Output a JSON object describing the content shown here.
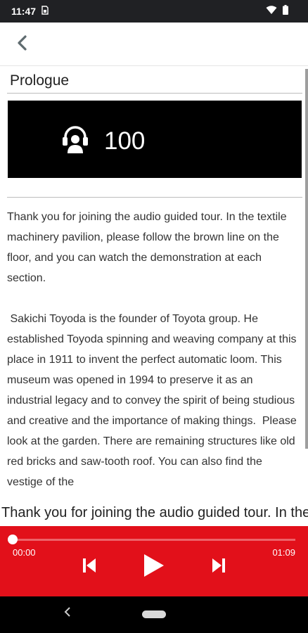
{
  "status_bar": {
    "time": "11:47",
    "sim_icon": "sim-card-icon",
    "wifi_icon": "wifi-icon",
    "battery_icon": "battery-icon"
  },
  "app_bar": {
    "back_icon": "chevron-left-icon"
  },
  "content": {
    "section_title": "Prologue",
    "track": {
      "icon": "headphone-person-icon",
      "number": "100",
      "background": "#000000"
    },
    "body_text": "Thank you for joining the audio guided tour. In the textile machinery pavilion, please follow the brown line on the floor, and you can watch the demonstration at each section.\n\n Sakichi Toyoda is the founder of Toyota group. He established Toyoda spinning and weaving company at this place in 1911 to invent the perfect automatic loom. This museum was opened in 1994 to preserve it as an industrial legacy and to convey the spirit of being studious and creative and the importance of making things.  Please look at the garden. There are remaining structures like old red bricks and saw-tooth roof. You can also find the vestige of the"
  },
  "ticker_text": "Thank you for joining the audio guided tour. In the textile machinery pavilion, please follow the brown line on the floor",
  "player": {
    "accent_color": "#e2101a",
    "progress": 0,
    "elapsed": "00:00",
    "total": "01:09",
    "prev_icon": "skip-previous-icon",
    "play_icon": "play-icon",
    "next_icon": "skip-next-icon"
  },
  "nav_bar": {
    "back_icon": "nav-back-icon",
    "home_icon": "nav-home-pill"
  }
}
